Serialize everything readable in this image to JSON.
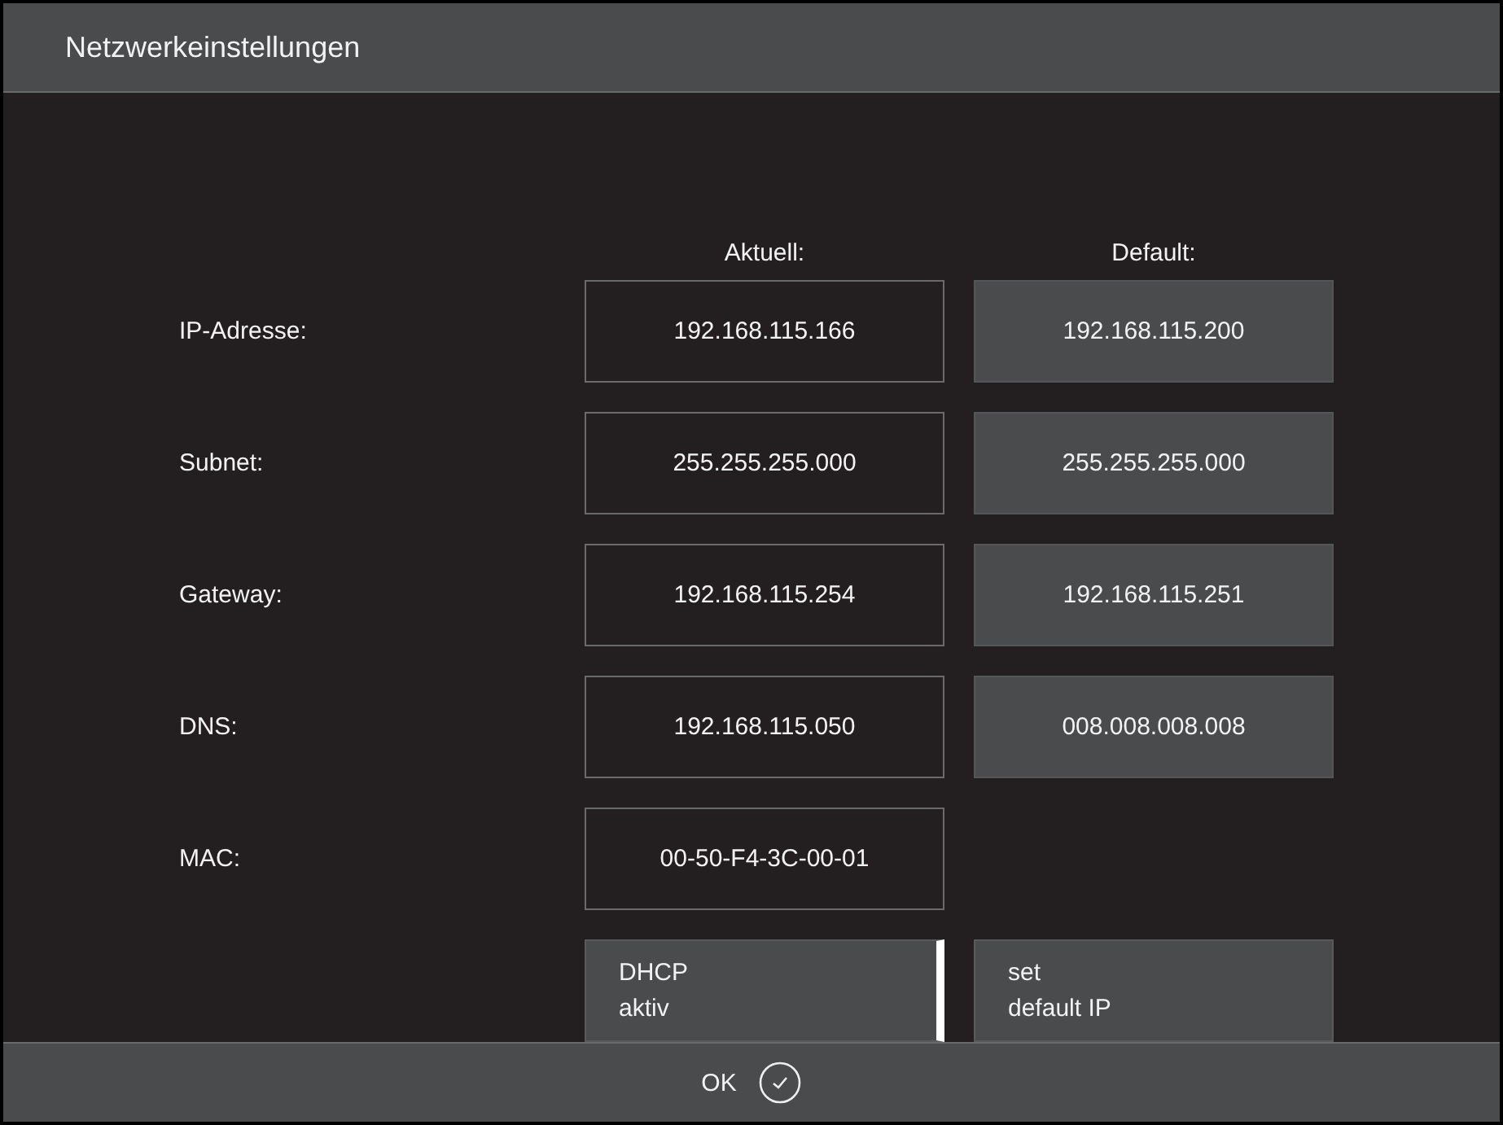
{
  "window": {
    "title": "Netzwerkeinstellungen"
  },
  "columns": [
    "Aktuell:",
    "Default:"
  ],
  "rows": [
    {
      "label": "IP-Adresse:",
      "current": "192.168.115.166",
      "default": "192.168.115.200"
    },
    {
      "label": "Subnet:",
      "current": "255.255.255.000",
      "default": "255.255.255.000"
    },
    {
      "label": "Gateway:",
      "current": "192.168.115.254",
      "default": "192.168.115.251"
    },
    {
      "label": "DNS:",
      "current": "192.168.115.050",
      "default": "008.008.008.008"
    },
    {
      "label": "MAC:",
      "current": "00-50-F4-3C-00-01"
    }
  ],
  "buttons": [
    {
      "kind": "toggle",
      "lines": [
        "DHCP",
        "aktiv"
      ],
      "on": true
    },
    {
      "kind": "action",
      "lines": [
        "set",
        "default IP"
      ]
    }
  ],
  "footer": {
    "ok": "OK"
  }
}
